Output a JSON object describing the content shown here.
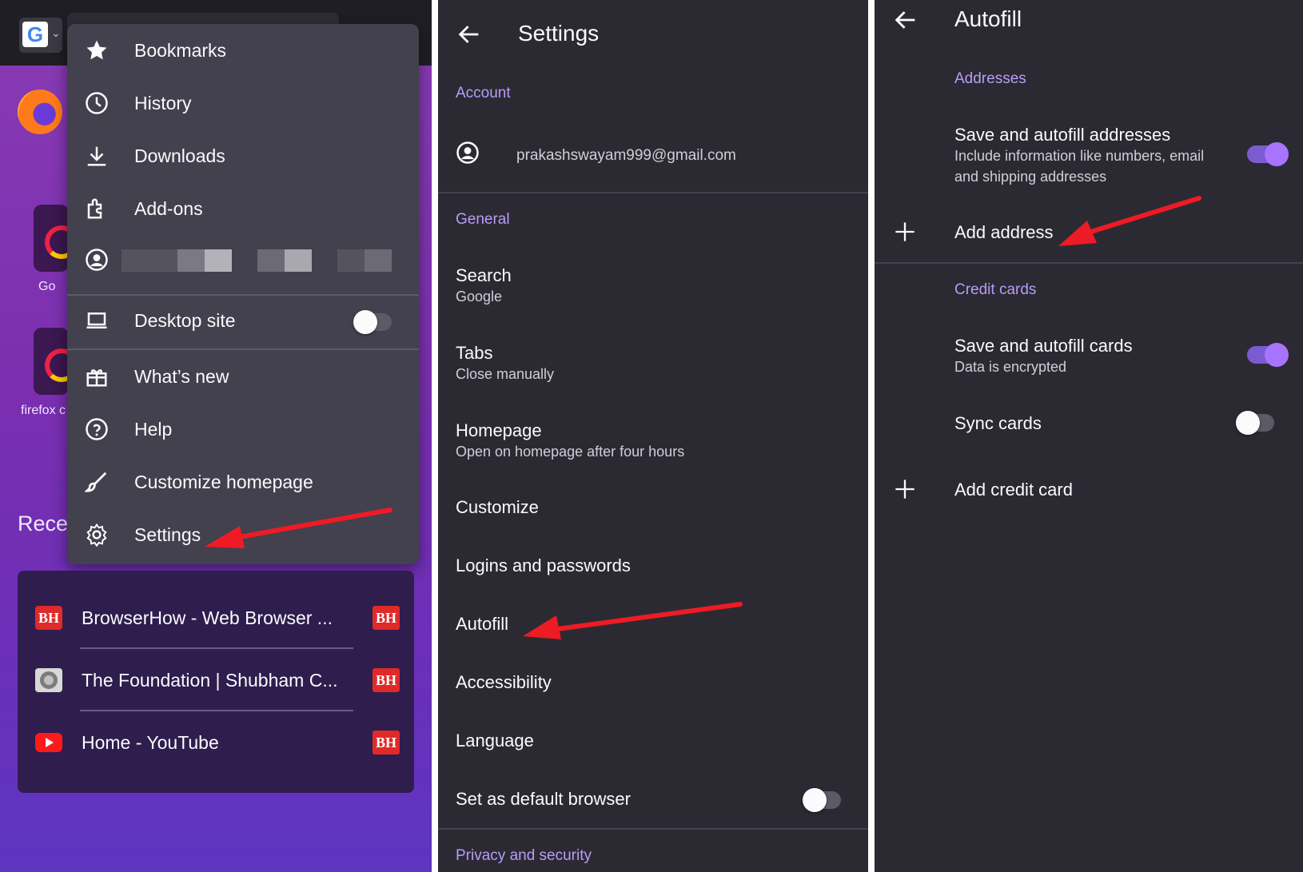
{
  "panel1": {
    "shortcut_labels": [
      "Go",
      "firefox c"
    ],
    "recent_heading": "Rece",
    "menu": {
      "items": [
        {
          "label": "Bookmarks",
          "icon": "star-icon"
        },
        {
          "label": "History",
          "icon": "clock-icon"
        },
        {
          "label": "Downloads",
          "icon": "download-icon"
        },
        {
          "label": "Add-ons",
          "icon": "puzzle-icon"
        },
        {
          "label": "",
          "icon": "account-icon"
        },
        {
          "label": "Desktop site",
          "icon": "laptop-icon",
          "toggle": false
        },
        {
          "label": "What’s new",
          "icon": "gift-icon"
        },
        {
          "label": "Help",
          "icon": "help-icon"
        },
        {
          "label": "Customize homepage",
          "icon": "brush-icon"
        },
        {
          "label": "Settings",
          "icon": "gear-icon"
        }
      ]
    },
    "recent": [
      {
        "title": "BrowserHow - Web Browser ...",
        "favicon": "BH",
        "badge": "BH"
      },
      {
        "title": "The Foundation | Shubham C...",
        "favicon": "foundation-icon",
        "badge": "BH"
      },
      {
        "title": "Home - YouTube",
        "favicon": "youtube-icon",
        "badge": "BH"
      }
    ]
  },
  "panel2": {
    "title": "Settings",
    "section_account": "Account",
    "email": "prakashswayam999@gmail.com",
    "section_general": "General",
    "items": [
      {
        "title": "Search",
        "subtitle": "Google"
      },
      {
        "title": "Tabs",
        "subtitle": "Close manually"
      },
      {
        "title": "Homepage",
        "subtitle": "Open on homepage after four hours"
      },
      {
        "title": "Customize",
        "subtitle": ""
      },
      {
        "title": "Logins and passwords",
        "subtitle": ""
      },
      {
        "title": "Autofill",
        "subtitle": ""
      },
      {
        "title": "Accessibility",
        "subtitle": ""
      },
      {
        "title": "Language",
        "subtitle": ""
      },
      {
        "title": "Set as default browser",
        "subtitle": "",
        "toggle": false
      }
    ],
    "section_privacy": "Privacy and security"
  },
  "panel3": {
    "title": "Autofill",
    "section_addresses": "Addresses",
    "save_addresses": {
      "title": "Save and autofill addresses",
      "subtitle_line1": "Include information like numbers, email",
      "subtitle_line2": "and shipping addresses",
      "toggle": true
    },
    "add_address": "Add address",
    "section_cards": "Credit cards",
    "save_cards": {
      "title": "Save and autofill cards",
      "subtitle": "Data is encrypted",
      "toggle": true
    },
    "sync_cards": {
      "title": "Sync cards",
      "toggle": false
    },
    "add_card": "Add credit card"
  },
  "colors": {
    "panel_bg": "#2b2a33",
    "menu_bg": "#42414d",
    "accent": "#b89cf8",
    "toggle_on": "#a874ff",
    "arrow": "#ee1b24",
    "badge": "#e02a2a"
  }
}
